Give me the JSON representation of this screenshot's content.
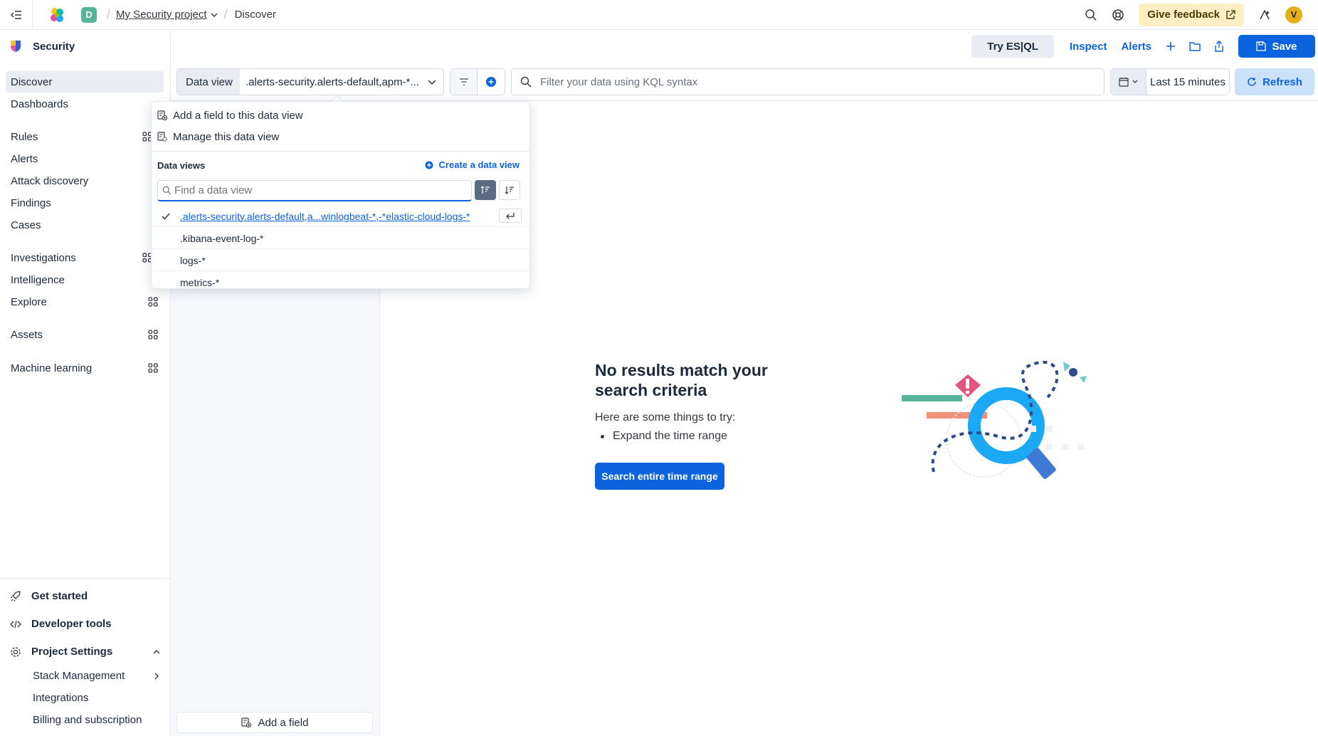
{
  "header": {
    "space_initial": "D",
    "project": "My Security project",
    "current_page": "Discover",
    "feedback_label": "Give feedback",
    "user_initial": "V"
  },
  "sidebar": {
    "title": "Security",
    "items": [
      {
        "label": "Discover"
      },
      {
        "label": "Dashboards"
      },
      {
        "label": "Rules"
      },
      {
        "label": "Alerts"
      },
      {
        "label": "Attack discovery"
      },
      {
        "label": "Findings"
      },
      {
        "label": "Cases"
      },
      {
        "label": "Investigations"
      },
      {
        "label": "Intelligence"
      },
      {
        "label": "Explore"
      },
      {
        "label": "Assets"
      },
      {
        "label": "Machine learning"
      }
    ],
    "bottom": {
      "get_started": "Get started",
      "developer_tools": "Developer tools",
      "project_settings": "Project Settings",
      "sub_items": [
        "Stack Management",
        "Integrations",
        "Billing and subscription"
      ]
    }
  },
  "actions": {
    "esql_label": "Try ES|QL",
    "inspect_label": "Inspect",
    "alerts_label": "Alerts",
    "save_label": "Save"
  },
  "query": {
    "data_view_label": "Data view",
    "data_view_value": ".alerts-security.alerts-default,apm-*...",
    "kql_placeholder": "Filter your data using KQL syntax",
    "time_range": "Last 15 minutes",
    "refresh_label": "Refresh"
  },
  "field_panel": {
    "add_field_label": "Add a field"
  },
  "popover": {
    "add_field": "Add a field to this data view",
    "manage": "Manage this data view",
    "section_title": "Data views",
    "create_label": "Create a data view",
    "search_placeholder": "Find a data view",
    "data_views": [
      {
        "name": ".alerts-security.alerts-default,a...winlogbeat-*,-*elastic-cloud-logs-*",
        "selected": true
      },
      {
        "name": ".kibana-event-log-*",
        "selected": false
      },
      {
        "name": "logs-*",
        "selected": false
      },
      {
        "name": "metrics-*",
        "selected": false
      }
    ]
  },
  "empty_state": {
    "title": "No results match your search criteria",
    "subtitle": "Here are some things to try:",
    "suggestion": "Expand the time range",
    "button_label": "Search entire time range"
  },
  "colors": {
    "primary": "#0b64dd",
    "feedback_bg": "#fcefc3",
    "space_badge": "#54b399",
    "avatar": "#e7b017"
  }
}
